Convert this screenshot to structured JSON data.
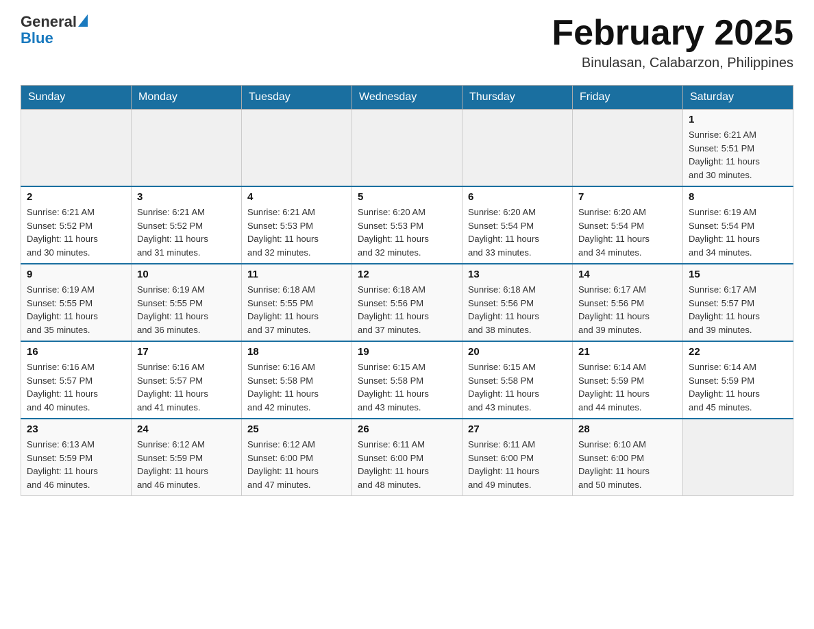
{
  "header": {
    "logo_general": "General",
    "logo_blue": "Blue",
    "title": "February 2025",
    "subtitle": "Binulasan, Calabarzon, Philippines"
  },
  "days_of_week": [
    "Sunday",
    "Monday",
    "Tuesday",
    "Wednesday",
    "Thursday",
    "Friday",
    "Saturday"
  ],
  "weeks": [
    [
      {
        "day": "",
        "info": ""
      },
      {
        "day": "",
        "info": ""
      },
      {
        "day": "",
        "info": ""
      },
      {
        "day": "",
        "info": ""
      },
      {
        "day": "",
        "info": ""
      },
      {
        "day": "",
        "info": ""
      },
      {
        "day": "1",
        "info": "Sunrise: 6:21 AM\nSunset: 5:51 PM\nDaylight: 11 hours\nand 30 minutes."
      }
    ],
    [
      {
        "day": "2",
        "info": "Sunrise: 6:21 AM\nSunset: 5:52 PM\nDaylight: 11 hours\nand 30 minutes."
      },
      {
        "day": "3",
        "info": "Sunrise: 6:21 AM\nSunset: 5:52 PM\nDaylight: 11 hours\nand 31 minutes."
      },
      {
        "day": "4",
        "info": "Sunrise: 6:21 AM\nSunset: 5:53 PM\nDaylight: 11 hours\nand 32 minutes."
      },
      {
        "day": "5",
        "info": "Sunrise: 6:20 AM\nSunset: 5:53 PM\nDaylight: 11 hours\nand 32 minutes."
      },
      {
        "day": "6",
        "info": "Sunrise: 6:20 AM\nSunset: 5:54 PM\nDaylight: 11 hours\nand 33 minutes."
      },
      {
        "day": "7",
        "info": "Sunrise: 6:20 AM\nSunset: 5:54 PM\nDaylight: 11 hours\nand 34 minutes."
      },
      {
        "day": "8",
        "info": "Sunrise: 6:19 AM\nSunset: 5:54 PM\nDaylight: 11 hours\nand 34 minutes."
      }
    ],
    [
      {
        "day": "9",
        "info": "Sunrise: 6:19 AM\nSunset: 5:55 PM\nDaylight: 11 hours\nand 35 minutes."
      },
      {
        "day": "10",
        "info": "Sunrise: 6:19 AM\nSunset: 5:55 PM\nDaylight: 11 hours\nand 36 minutes."
      },
      {
        "day": "11",
        "info": "Sunrise: 6:18 AM\nSunset: 5:55 PM\nDaylight: 11 hours\nand 37 minutes."
      },
      {
        "day": "12",
        "info": "Sunrise: 6:18 AM\nSunset: 5:56 PM\nDaylight: 11 hours\nand 37 minutes."
      },
      {
        "day": "13",
        "info": "Sunrise: 6:18 AM\nSunset: 5:56 PM\nDaylight: 11 hours\nand 38 minutes."
      },
      {
        "day": "14",
        "info": "Sunrise: 6:17 AM\nSunset: 5:56 PM\nDaylight: 11 hours\nand 39 minutes."
      },
      {
        "day": "15",
        "info": "Sunrise: 6:17 AM\nSunset: 5:57 PM\nDaylight: 11 hours\nand 39 minutes."
      }
    ],
    [
      {
        "day": "16",
        "info": "Sunrise: 6:16 AM\nSunset: 5:57 PM\nDaylight: 11 hours\nand 40 minutes."
      },
      {
        "day": "17",
        "info": "Sunrise: 6:16 AM\nSunset: 5:57 PM\nDaylight: 11 hours\nand 41 minutes."
      },
      {
        "day": "18",
        "info": "Sunrise: 6:16 AM\nSunset: 5:58 PM\nDaylight: 11 hours\nand 42 minutes."
      },
      {
        "day": "19",
        "info": "Sunrise: 6:15 AM\nSunset: 5:58 PM\nDaylight: 11 hours\nand 43 minutes."
      },
      {
        "day": "20",
        "info": "Sunrise: 6:15 AM\nSunset: 5:58 PM\nDaylight: 11 hours\nand 43 minutes."
      },
      {
        "day": "21",
        "info": "Sunrise: 6:14 AM\nSunset: 5:59 PM\nDaylight: 11 hours\nand 44 minutes."
      },
      {
        "day": "22",
        "info": "Sunrise: 6:14 AM\nSunset: 5:59 PM\nDaylight: 11 hours\nand 45 minutes."
      }
    ],
    [
      {
        "day": "23",
        "info": "Sunrise: 6:13 AM\nSunset: 5:59 PM\nDaylight: 11 hours\nand 46 minutes."
      },
      {
        "day": "24",
        "info": "Sunrise: 6:12 AM\nSunset: 5:59 PM\nDaylight: 11 hours\nand 46 minutes."
      },
      {
        "day": "25",
        "info": "Sunrise: 6:12 AM\nSunset: 6:00 PM\nDaylight: 11 hours\nand 47 minutes."
      },
      {
        "day": "26",
        "info": "Sunrise: 6:11 AM\nSunset: 6:00 PM\nDaylight: 11 hours\nand 48 minutes."
      },
      {
        "day": "27",
        "info": "Sunrise: 6:11 AM\nSunset: 6:00 PM\nDaylight: 11 hours\nand 49 minutes."
      },
      {
        "day": "28",
        "info": "Sunrise: 6:10 AM\nSunset: 6:00 PM\nDaylight: 11 hours\nand 50 minutes."
      },
      {
        "day": "",
        "info": ""
      }
    ]
  ]
}
